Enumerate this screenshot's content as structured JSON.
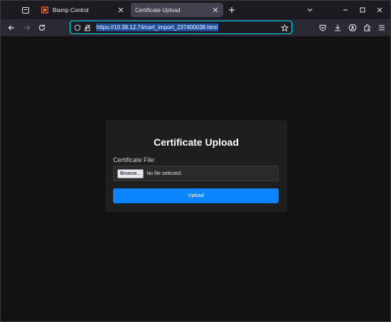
{
  "browser": {
    "tabs": [
      {
        "title": "Biamp Control",
        "active": false,
        "favicon_color": "#e8683a"
      },
      {
        "title": "Certificate Upload",
        "active": true
      }
    ],
    "url": "https://10.38.12.74/cert_import_237400038.html"
  },
  "page": {
    "heading": "Certificate Upload",
    "file_label": "Certificate File:",
    "browse_label": "Browse...",
    "file_status": "No file selected.",
    "upload_label": "Upload"
  },
  "colors": {
    "accent": "#0a84ff",
    "url_focus": "#00ddff",
    "background": "#121212",
    "card": "#1e1e1e"
  }
}
